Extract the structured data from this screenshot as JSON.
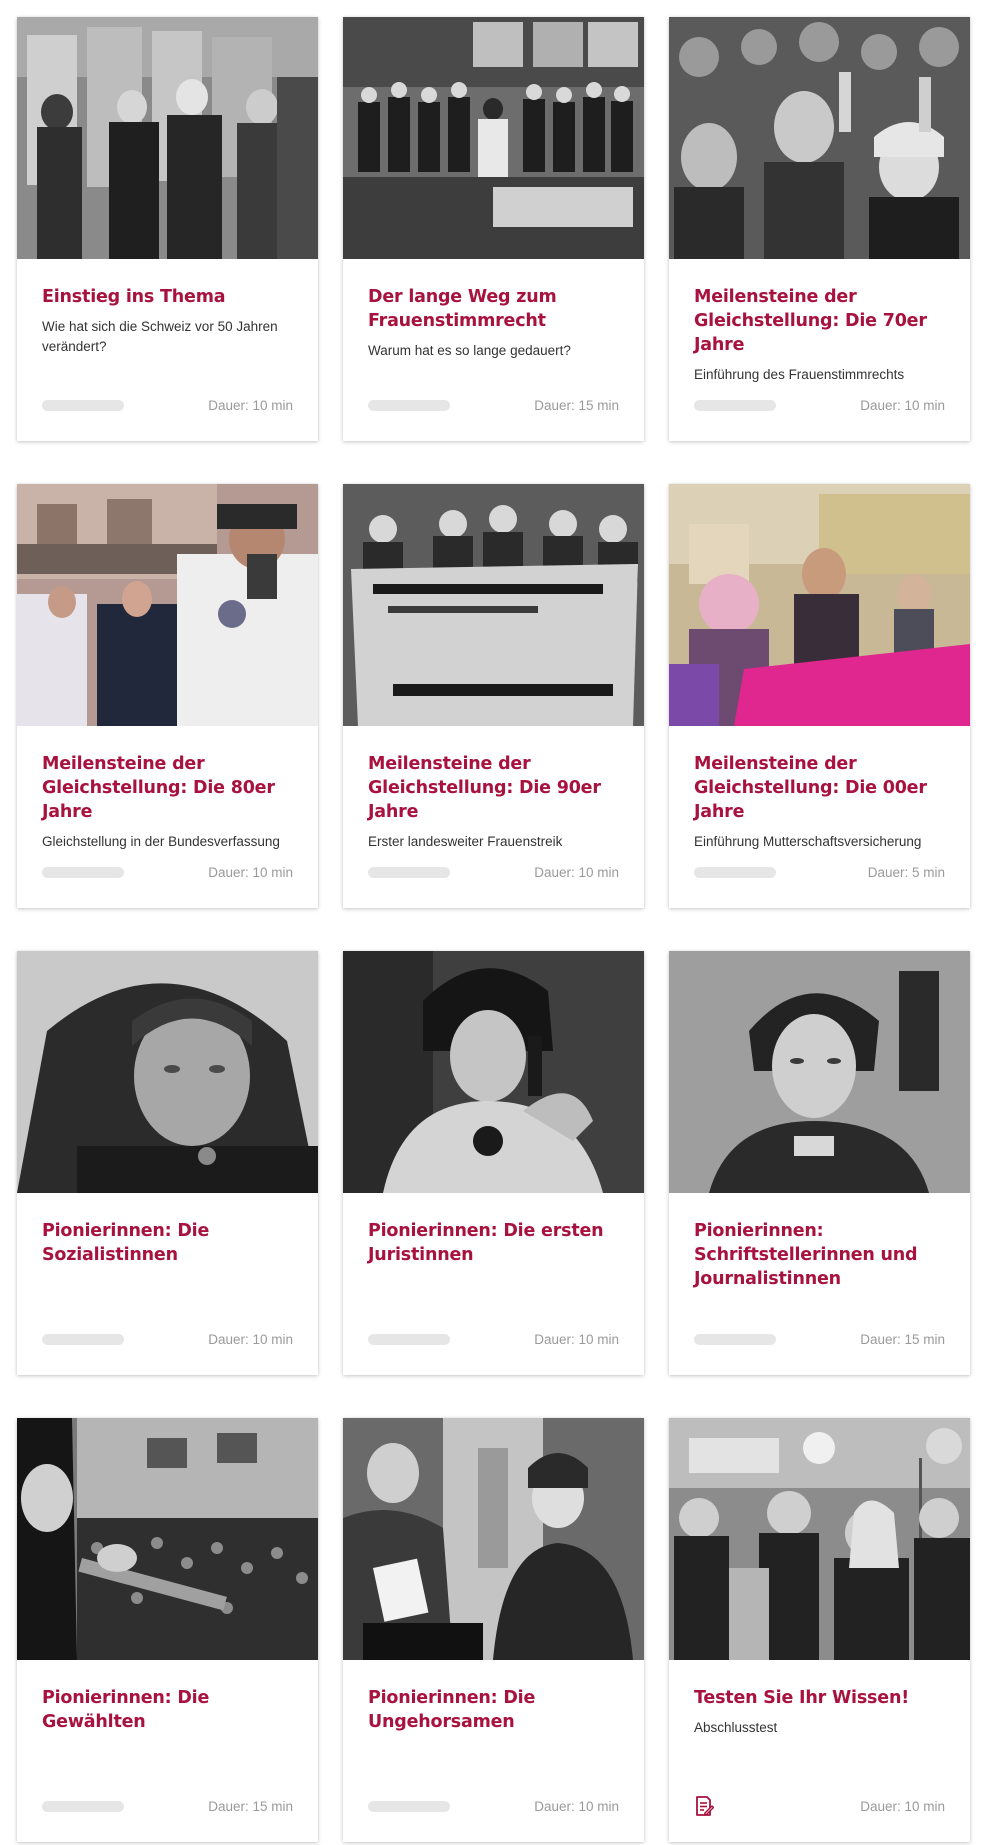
{
  "accent_color": "#a8123e",
  "cards": [
    {
      "title": "Einstieg ins Thema",
      "subtitle": "Wie hat sich die Schweiz vor 50 Jahren verändert?",
      "duration": "Dauer: 10 min",
      "progress": 0,
      "image": "photo-women-at-voting-booths"
    },
    {
      "title": "Der lange Weg zum Frauenstimmrecht",
      "subtitle": "Warum hat es so lange gedauert?",
      "duration": "Dauer: 15 min",
      "progress": 0,
      "image": "photo-parliament-chamber"
    },
    {
      "title": "Meilensteine der Gleichstellung: Die 70er Jahre",
      "subtitle": "Einführung des Frauenstimmrechts",
      "duration": "Dauer: 10 min",
      "progress": 0,
      "image": "photo-raised-hands-vote"
    },
    {
      "title": "Meilensteine der Gleichstellung: Die 80er Jahre",
      "subtitle": "Gleichstellung in der Bundesverfassung",
      "duration": "Dauer: 10 min",
      "progress": 0,
      "image": "photo-landsgemeinde-ceremony"
    },
    {
      "title": "Meilensteine der Gleichstellung: Die 90er Jahre",
      "subtitle": "Erster landesweiter Frauenstreik",
      "duration": "Dauer: 10 min",
      "progress": 0,
      "image": "photo-protest-banner"
    },
    {
      "title": "Meilensteine der Gleichstellung: Die 00er Jahre",
      "subtitle": "Einführung Mutterschaftsversicherung",
      "duration": "Dauer: 5 min",
      "progress": 0,
      "image": "photo-colorful-demonstration"
    },
    {
      "title": "Pionierinnen: Die Sozialistinnen",
      "subtitle": "",
      "duration": "Dauer: 10 min",
      "progress": 0,
      "image": "photo-portrait-older-woman"
    },
    {
      "title": "Pionierinnen: Die ersten Juristinnen",
      "subtitle": "",
      "duration": "Dauer: 10 min",
      "progress": 0,
      "image": "photo-woman-on-telephone"
    },
    {
      "title": "Pionierinnen: Schriftstellerinnen und Journalistinnen",
      "subtitle": "",
      "duration": "Dauer: 15 min",
      "progress": 0,
      "image": "photo-portrait-young-woman"
    },
    {
      "title": "Pionierinnen: Die Gewählten",
      "subtitle": "",
      "duration": "Dauer: 15 min",
      "progress": 0,
      "image": "photo-speech-to-crowd"
    },
    {
      "title": "Pionierinnen: Die Ungehorsamen",
      "subtitle": "",
      "duration": "Dauer: 10 min",
      "progress": 0,
      "image": "photo-woman-casting-ballot"
    },
    {
      "title": "Testen Sie Ihr Wissen!",
      "subtitle": "Abschlusstest",
      "duration": "Dauer: 10 min",
      "icon": "test-document-icon",
      "image": "photo-demonstration-signs"
    }
  ]
}
